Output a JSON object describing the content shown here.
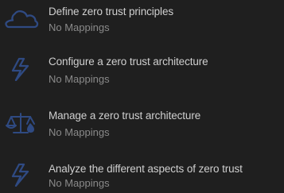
{
  "colors": {
    "background": "#1f1f1f",
    "title_text": "#cfcfcf",
    "subtitle_text": "#8a8a8a",
    "icon": "#2f4a82"
  },
  "items": [
    {
      "title": "Define zero trust principles",
      "subtitle": "No Mappings",
      "icon": "cloud-icon"
    },
    {
      "title": "Configure a zero trust architecture",
      "subtitle": "No Mappings",
      "icon": "lightning-bolt-icon"
    },
    {
      "title": "Manage a zero trust architecture",
      "subtitle": "No Mappings",
      "icon": "balance-scale-icon"
    },
    {
      "title": "Analyze the different aspects of zero trust",
      "subtitle": "No Mappings",
      "icon": "lightning-bolt-icon"
    }
  ]
}
